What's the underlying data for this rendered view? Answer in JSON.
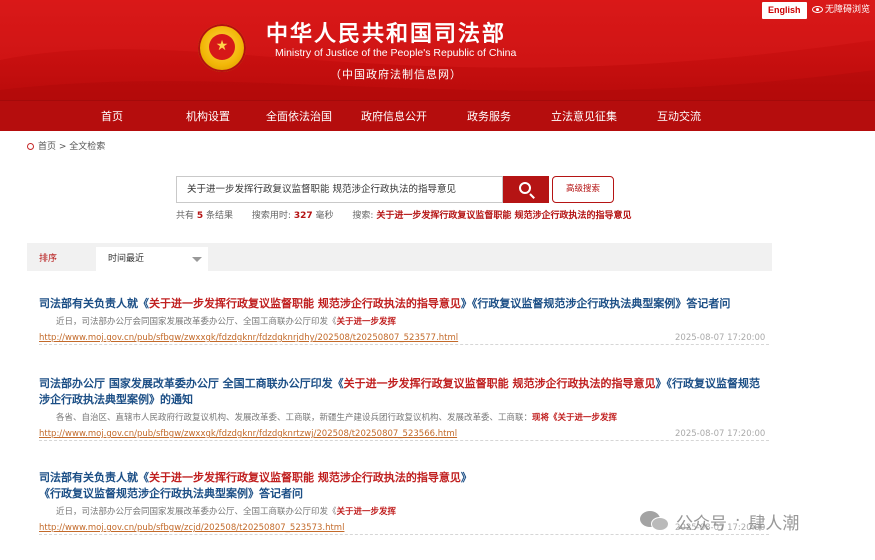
{
  "header": {
    "title_cn": "中华人民共和国司法部",
    "title_en": "Ministry of Justice of the People's Republic of China",
    "subtitle": "（中国政府法制信息网）",
    "english_button": "English",
    "a11y_label": "无障碍浏览"
  },
  "nav": {
    "items": [
      {
        "label": "首页"
      },
      {
        "label": "机构设置"
      },
      {
        "label": "全面依法治国"
      },
      {
        "label": "政府信息公开"
      },
      {
        "label": "政务服务"
      },
      {
        "label": "立法意见征集"
      },
      {
        "label": "互动交流"
      }
    ]
  },
  "breadcrumb": {
    "text": "首页 > 全文检索"
  },
  "search": {
    "value": "关于进一步发挥行政复议监督职能 规范涉企行政执法的指导意见",
    "advanced_label": "高级搜索"
  },
  "stats": {
    "prefix": "共有",
    "count": "5",
    "suffix": "条结果",
    "time_label": "搜索用时:",
    "time_value": "327",
    "time_unit": "毫秒",
    "kw_label": "搜索:",
    "kw_value": "关于进一步发挥行政复议监督职能 规范涉企行政执法的指导意见"
  },
  "sort": {
    "label": "排序",
    "selected": "时间最近"
  },
  "results": [
    {
      "title_a": "司法部有关负责人就《",
      "title_hl": "关于进一步发挥行政复议监督职能 规范涉企行政执法的指导意见",
      "title_b": "》《行政复议监督规范涉企行政执法典型案例》答记者问",
      "snippet": "近日，司法部办公厅会同国家发展改革委办公厅、全国工商联办公厅印发《",
      "snippet_hl": "关于进一步发挥",
      "url": "http://www.moj.gov.cn/pub/sfbgw/zwxxgk/fdzdgknr/fdzdgknrjdhy/202508/t20250807_523577.html",
      "date": "2025-08-07 17:20:00"
    },
    {
      "title_a": "司法部办公厅 国家发展改革委办公厅 全国工商联办公厅印发《",
      "title_hl": "关于进一步发挥行政复议监督职能 规范涉企行政执法的指导意见",
      "title_b": "》《行政复议监督规范涉企行政执法典型案例》的通知",
      "snippet": "各省、自治区、直辖市人民政府行政复议机构、发展改革委、工商联，新疆生产建设兵团行政复议机构、发展改革委、工商联：",
      "snippet_hl": "现将《关于进一步发挥",
      "url": "http://www.moj.gov.cn/pub/sfbgw/zwxxgk/fdzdgknr/fdzdgknrtzwj/202508/t20250807_523566.html",
      "date": "2025-08-07 17:20:00"
    },
    {
      "title_a": "司法部有关负责人就《",
      "title_hl": "关于进一步发挥行政复议监督职能 规范涉企行政执法的指导意见",
      "title_b": "》《行政复议监督规范涉企行政执法典型案例》答记者问",
      "snippet": "近日，司法部办公厅会同国家发展改革委办公厅、全国工商联办公厅印发《",
      "snippet_hl": "关于进一步发挥",
      "url": "http://www.moj.gov.cn/pub/sfbgw/zcjd/202508/t20250807_523573.html",
      "date": "2025-08-07 17:20:00"
    }
  ],
  "watermark": {
    "a": "公众号",
    "dot": "·",
    "b": "肆人潮"
  },
  "colors": {
    "brand_red": "#c70f0f",
    "nav_red": "#b50d0d",
    "link_blue": "#1c4f86",
    "highlight_red": "#c01f1f",
    "url_orange": "#c36a2a"
  }
}
